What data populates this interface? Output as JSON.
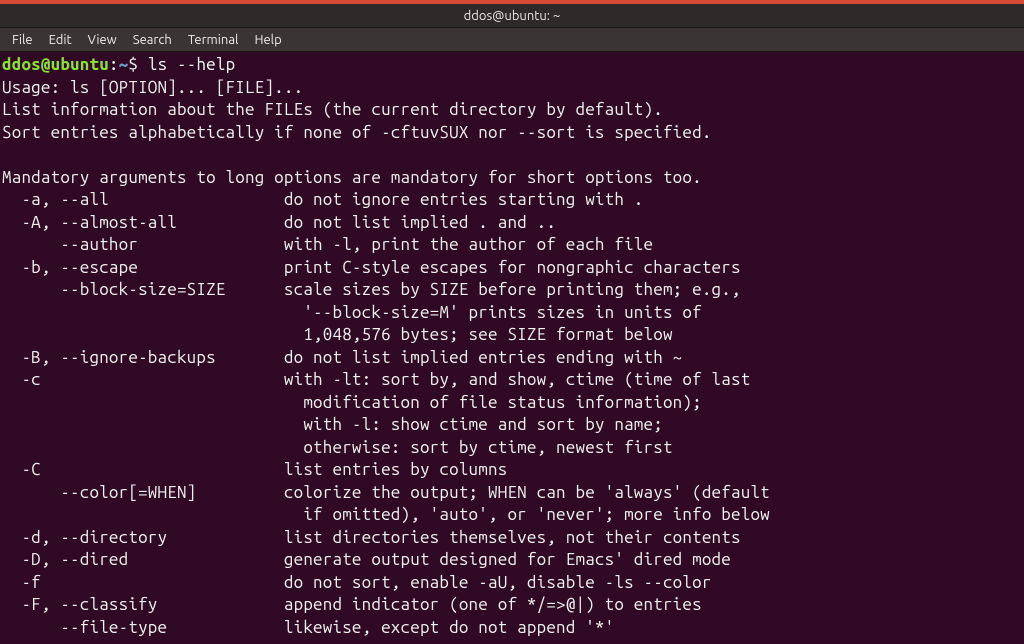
{
  "window": {
    "title": "ddos@ubuntu: ~"
  },
  "menubar": {
    "items": [
      "File",
      "Edit",
      "View",
      "Search",
      "Terminal",
      "Help"
    ]
  },
  "prompt": {
    "userhost": "ddos@ubuntu",
    "colon": ":",
    "path": "~",
    "sigil": "$ "
  },
  "command": "ls --help",
  "output_lines": [
    "Usage: ls [OPTION]... [FILE]...",
    "List information about the FILEs (the current directory by default).",
    "Sort entries alphabetically if none of -cftuvSUX nor --sort is specified.",
    "",
    "Mandatory arguments to long options are mandatory for short options too.",
    "  -a, --all                  do not ignore entries starting with .",
    "  -A, --almost-all           do not list implied . and ..",
    "      --author               with -l, print the author of each file",
    "  -b, --escape               print C-style escapes for nongraphic characters",
    "      --block-size=SIZE      scale sizes by SIZE before printing them; e.g.,",
    "                               '--block-size=M' prints sizes in units of",
    "                               1,048,576 bytes; see SIZE format below",
    "  -B, --ignore-backups       do not list implied entries ending with ~",
    "  -c                         with -lt: sort by, and show, ctime (time of last",
    "                               modification of file status information);",
    "                               with -l: show ctime and sort by name;",
    "                               otherwise: sort by ctime, newest first",
    "  -C                         list entries by columns",
    "      --color[=WHEN]         colorize the output; WHEN can be 'always' (default",
    "                               if omitted), 'auto', or 'never'; more info below",
    "  -d, --directory            list directories themselves, not their contents",
    "  -D, --dired                generate output designed for Emacs' dired mode",
    "  -f                         do not sort, enable -aU, disable -ls --color",
    "  -F, --classify             append indicator (one of */=>@|) to entries",
    "      --file-type            likewise, except do not append '*'"
  ]
}
